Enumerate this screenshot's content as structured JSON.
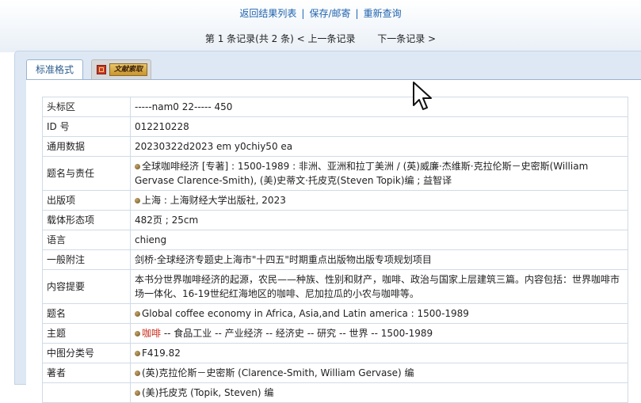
{
  "top_links": {
    "back_to_results": "返回结果列表",
    "save_mail": "保存/邮寄",
    "research": "重新查询",
    "separator": "|"
  },
  "record_nav": {
    "position": "第 1 条记录(共 2 条)",
    "prev": "< 上一条记录",
    "next": "下一条记录 >"
  },
  "tabs": {
    "standard": "标准格式",
    "literature_search": "文献索取"
  },
  "fields": [
    {
      "label": "头标区",
      "value": "-----nam0 22----- 450"
    },
    {
      "label": "ID 号",
      "value": "012210228"
    },
    {
      "label": "通用数据",
      "value": "20230322d2023 em y0chiy50 ea"
    },
    {
      "label": "题名与责任",
      "value": "全球咖啡经济 [专著] : 1500-1989 : 非洲、亚洲和拉丁美洲 / (英)威廉·杰维斯·克拉伦斯－史密斯(William Gervase Clarence-Smith), (美)史蒂文·托皮克(Steven Topik)编 ; 益智译"
    },
    {
      "label": "出版项",
      "value": "上海 : 上海财经大学出版社, 2023"
    },
    {
      "label": "载体形态项",
      "value": "482页 ; 25cm"
    },
    {
      "label": "语言",
      "value": "chieng"
    },
    {
      "label": "一般附注",
      "value": "剑桥·全球经济专题史上海市\"十四五\"时期重点出版物出版专项规划项目"
    },
    {
      "label": "内容提要",
      "value": "本书分世界咖啡经济的起源，农民——种族、性别和财产，咖啡、政治与国家上层建筑三篇。内容包括：世界咖啡市场一体化、16-19世纪红海地区的咖啡、尼加拉瓜的小农与咖啡等。"
    },
    {
      "label": "题名",
      "value": "Global coffee economy in Africa, Asia,and Latin america : 1500-1989"
    },
    {
      "label": "主题",
      "link": "咖啡",
      "value": " -- 食品工业 -- 产业经济 -- 经济史 -- 研究 -- 世界 -- 1500-1989"
    },
    {
      "label": "中图分类号",
      "value": "F419.82"
    },
    {
      "label": "著者",
      "value": "(英)克拉伦斯－史密斯 (Clarence-Smith, William Gervase) 编"
    },
    {
      "label": "",
      "value": "(美)托皮克 (Topik, Steven) 编"
    }
  ]
}
